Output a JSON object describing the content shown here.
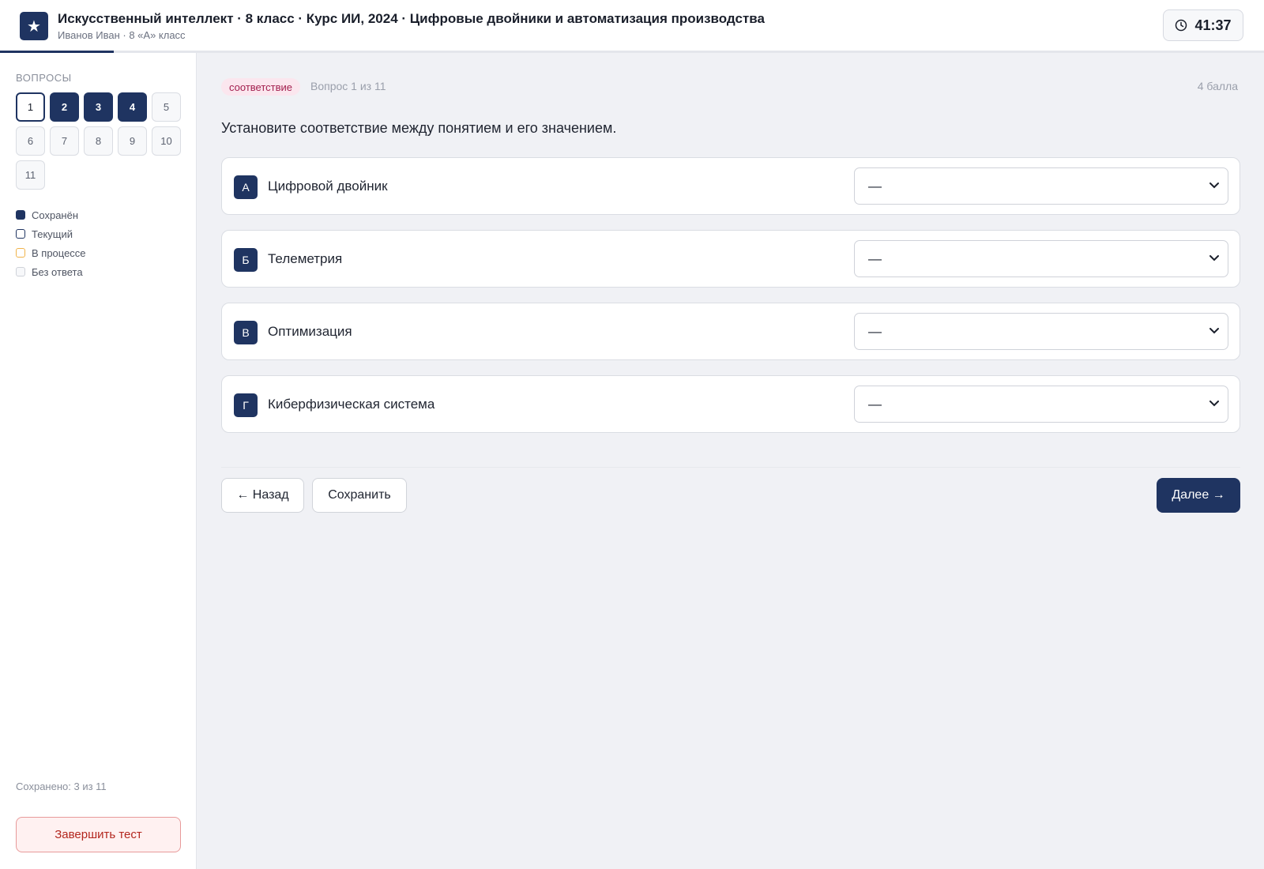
{
  "header": {
    "title": "Искусственный интеллект · 8 класс · Курс ИИ, 2024 · Цифровые двойники и автоматизация производства",
    "subtitle": "Иванов Иван · 8 «А» класс",
    "timer": "41:37",
    "progress": 0.09
  },
  "sidebar": {
    "heading": "ВОПРОСЫ",
    "questions": [
      {
        "label": "1",
        "state": "current"
      },
      {
        "label": "2",
        "state": "saved"
      },
      {
        "label": "3",
        "state": "saved"
      },
      {
        "label": "4",
        "state": "saved"
      },
      {
        "label": "5",
        "state": "empty"
      },
      {
        "label": "6",
        "state": "empty"
      },
      {
        "label": "7",
        "state": "empty"
      },
      {
        "label": "8",
        "state": "empty"
      },
      {
        "label": "9",
        "state": "empty"
      },
      {
        "label": "10",
        "state": "empty"
      },
      {
        "label": "11",
        "state": "empty"
      }
    ],
    "legend": {
      "saved": "Сохранён",
      "current": "Текущий",
      "in_progress": "В процессе",
      "empty": "Без ответа"
    },
    "saved_count": "Сохранено: 3 из 11",
    "finish_label": "Завершить тест"
  },
  "main": {
    "tag": "соответствие",
    "counter": "Вопрос 1 из 11",
    "points": "4 балла",
    "question": "Установите соответствие между понятием и его значением.",
    "rows": [
      {
        "letter": "А",
        "term": "Цифровой двойник",
        "selected": "—"
      },
      {
        "letter": "Б",
        "term": "Телеметрия",
        "selected": "—"
      },
      {
        "letter": "В",
        "term": "Оптимизация",
        "selected": "—"
      },
      {
        "letter": "Г",
        "term": "Киберфизическая система",
        "selected": "—"
      }
    ],
    "buttons": {
      "back": "← Назад",
      "save": "Сохранить",
      "next": "Далее →"
    }
  },
  "colors": {
    "accent": "#1f3461",
    "tag_text": "#a3204f",
    "tag_bg": "#fbe6ee",
    "danger": "#b3261e",
    "in_progress": "#f0b34a"
  }
}
